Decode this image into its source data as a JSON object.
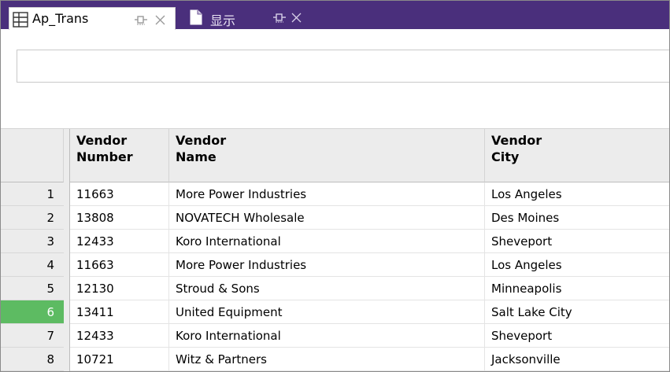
{
  "tabs": [
    {
      "label": "Ap_Trans",
      "icon": "table-icon",
      "pin_icon": "pin-icon",
      "close_icon": "close-icon",
      "active": true
    },
    {
      "label": "显示",
      "icon": "document-icon",
      "pin_icon": "pin-icon",
      "close_icon": "close-icon",
      "active": false
    }
  ],
  "filter": {
    "value": "",
    "placeholder": ""
  },
  "table": {
    "headers": [
      {
        "line1": "Vendor",
        "line2": "Number"
      },
      {
        "line1": "Vendor",
        "line2": "Name"
      },
      {
        "line1": "Vendor",
        "line2": "City"
      }
    ],
    "rows": [
      {
        "num": "1",
        "vendor_number": "11663",
        "vendor_name": "More Power Industries",
        "vendor_city": "Los Angeles"
      },
      {
        "num": "2",
        "vendor_number": "13808",
        "vendor_name": "NOVATECH Wholesale",
        "vendor_city": "Des Moines"
      },
      {
        "num": "3",
        "vendor_number": "12433",
        "vendor_name": "Koro International",
        "vendor_city": "Sheveport"
      },
      {
        "num": "4",
        "vendor_number": "11663",
        "vendor_name": "More Power Industries",
        "vendor_city": "Los Angeles"
      },
      {
        "num": "5",
        "vendor_number": "12130",
        "vendor_name": "Stroud & Sons",
        "vendor_city": "Minneapolis"
      },
      {
        "num": "6",
        "vendor_number": "13411",
        "vendor_name": "United Equipment",
        "vendor_city": "Salt Lake City"
      },
      {
        "num": "7",
        "vendor_number": "12433",
        "vendor_name": "Koro International",
        "vendor_city": "Sheveport"
      },
      {
        "num": "8",
        "vendor_number": "10721",
        "vendor_name": "Witz & Partners",
        "vendor_city": "Jacksonville"
      }
    ],
    "selected_row": "6"
  },
  "colors": {
    "tab_bar": "#4a2f7c",
    "selected_row_marker": "#5dbb62",
    "header_bg": "#ececec"
  }
}
